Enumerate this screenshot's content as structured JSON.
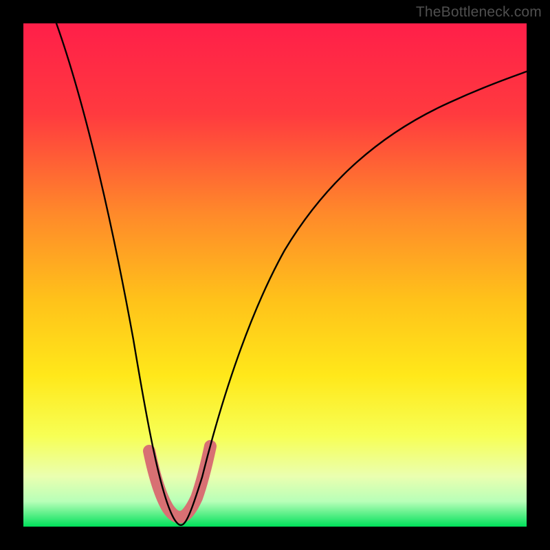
{
  "watermark": "TheBottleneck.com",
  "chart_data": {
    "type": "line",
    "title": "",
    "xlabel": "",
    "ylabel": "",
    "x": [
      0,
      0.05,
      0.1,
      0.15,
      0.2,
      0.25,
      0.28,
      0.3,
      0.32,
      0.35,
      0.4,
      0.45,
      0.5,
      0.55,
      0.6,
      0.7,
      0.8,
      0.9,
      1.0
    ],
    "series": [
      {
        "name": "bottleneck-curve",
        "values": [
          1.0,
          0.87,
          0.73,
          0.58,
          0.4,
          0.15,
          0.02,
          0.0,
          0.02,
          0.15,
          0.35,
          0.48,
          0.57,
          0.63,
          0.68,
          0.75,
          0.8,
          0.84,
          0.87
        ]
      }
    ],
    "highlight_range_x": [
      0.25,
      0.35
    ],
    "xlim": [
      0,
      1
    ],
    "ylim": [
      0,
      1
    ],
    "legend": false,
    "grid": false,
    "background_gradient": {
      "top": "#ff1f49",
      "upper_mid": "#ff7a2a",
      "mid": "#ffd21a",
      "lower_mid": "#f7ff6a",
      "bottom": "#00e05a"
    }
  }
}
